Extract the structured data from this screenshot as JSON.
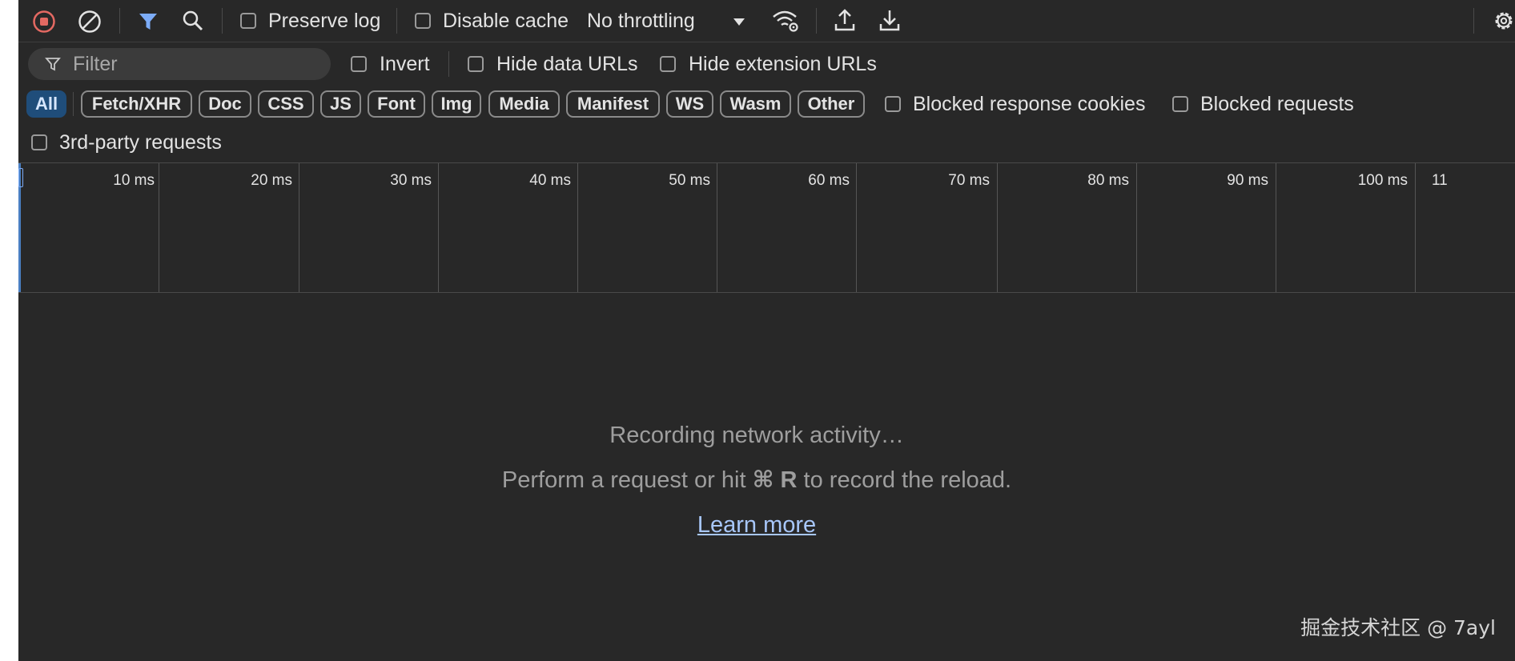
{
  "toolbar": {
    "preserve_log": "Preserve log",
    "disable_cache": "Disable cache",
    "throttling": "No throttling"
  },
  "filter_bar": {
    "placeholder": "Filter",
    "invert": "Invert",
    "hide_data_urls": "Hide data URLs",
    "hide_extension_urls": "Hide extension URLs"
  },
  "type_filters": [
    "All",
    "Fetch/XHR",
    "Doc",
    "CSS",
    "JS",
    "Font",
    "Img",
    "Media",
    "Manifest",
    "WS",
    "Wasm",
    "Other"
  ],
  "extra_filters": {
    "blocked_response_cookies": "Blocked response cookies",
    "blocked_requests": "Blocked requests",
    "third_party": "3rd-party requests"
  },
  "timeline": {
    "ticks": [
      "10 ms",
      "20 ms",
      "30 ms",
      "40 ms",
      "50 ms",
      "60 ms",
      "70 ms",
      "80 ms",
      "90 ms",
      "100 ms",
      "11"
    ]
  },
  "empty_state": {
    "line1": "Recording network activity…",
    "line2_prefix": "Perform a request or hit ",
    "shortcut": "⌘ R",
    "line2_suffix": " to record the reload.",
    "link": "Learn more"
  },
  "watermark": "掘金技术社区 @ 7ayl",
  "colors": {
    "background": "#282828",
    "record_red": "#e46962",
    "filter_blue": "#7cacf8",
    "link_blue": "#a8c7fa",
    "active_chip": "#1f4d7a"
  },
  "icons": [
    "record-stop-icon",
    "clear-icon",
    "filter-icon",
    "search-icon",
    "network-conditions-icon",
    "import-har-icon",
    "export-har-icon",
    "settings-icon"
  ]
}
